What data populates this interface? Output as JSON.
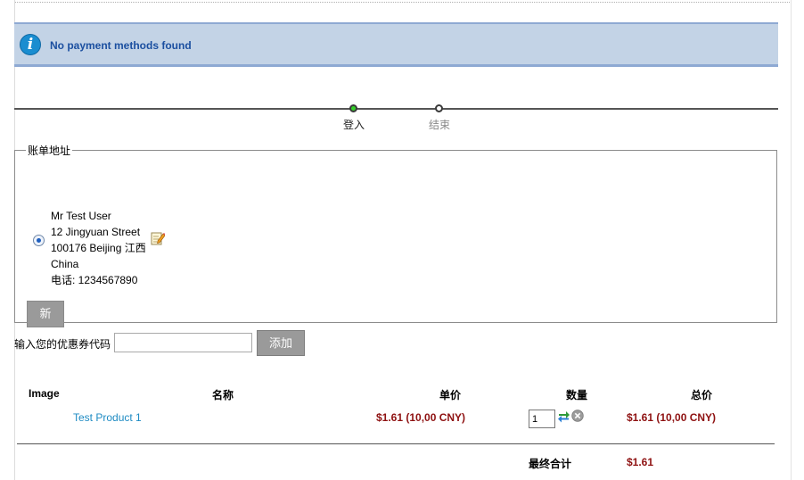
{
  "notice": {
    "icon": "info-icon",
    "message": "No payment methods found"
  },
  "steps": [
    {
      "label": "登入",
      "state": "done"
    },
    {
      "label": "结束",
      "state": "pending"
    }
  ],
  "billing": {
    "legend": "账单地址",
    "address": {
      "name": "Mr Test User",
      "street": "12 Jingyuan Street",
      "city_line": "100176 Beijing 江西",
      "country": "China",
      "phone": "电话: 1234567890",
      "selected": true
    },
    "new_button": "新"
  },
  "coupon": {
    "label": "输入您的优惠券代码",
    "value": "",
    "button": "添加"
  },
  "cart": {
    "headers": {
      "image": "Image",
      "name": "名称",
      "unit_price": "单价",
      "quantity": "数量",
      "total": "总价"
    },
    "rows": [
      {
        "product": "Test Product 1",
        "unit_price": "$1.61 (10,00 CNY)",
        "quantity": "1",
        "total": "$1.61 (10,00 CNY)"
      }
    ],
    "grand_total_label": "最终合计",
    "grand_total": "$1.61"
  },
  "colors": {
    "notice_bg": "#c3d3e6",
    "notice_border": "#8ea9d3",
    "notice_text": "#1b4fa0",
    "link": "#1e8bc3",
    "price": "#8e1111",
    "button": "#9a9a9a",
    "step_done": "#34d02a"
  }
}
